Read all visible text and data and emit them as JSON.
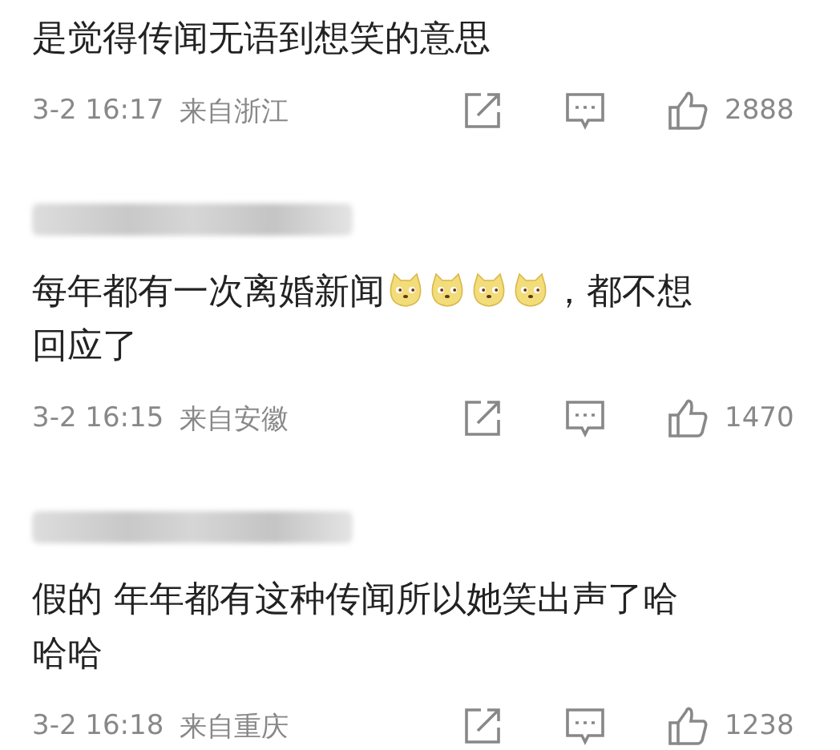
{
  "comments": [
    {
      "segments": [
        {
          "kind": "text",
          "text": "是觉得传闻无语到想笑的意思"
        }
      ],
      "time": "3-2 16:17",
      "location": "来自浙江",
      "likes": "2888"
    },
    {
      "author_hidden": true,
      "segments": [
        {
          "kind": "text",
          "text": "每年都有一次离婚新闻"
        },
        {
          "kind": "emoji"
        },
        {
          "kind": "emoji"
        },
        {
          "kind": "emoji"
        },
        {
          "kind": "emoji"
        },
        {
          "kind": "text",
          "text": "，都不想"
        },
        {
          "kind": "break"
        },
        {
          "kind": "text",
          "text": "回应了"
        }
      ],
      "time": "3-2 16:15",
      "location": "来自安徽",
      "likes": "1470"
    },
    {
      "author_hidden": true,
      "segments": [
        {
          "kind": "text",
          "text": "假的 年年都有这种传闻所以她笑出声了哈"
        },
        {
          "kind": "break"
        },
        {
          "kind": "text",
          "text": "哈哈"
        }
      ],
      "time": "3-2 16:18",
      "location": "来自重庆",
      "likes": "1238"
    }
  ]
}
